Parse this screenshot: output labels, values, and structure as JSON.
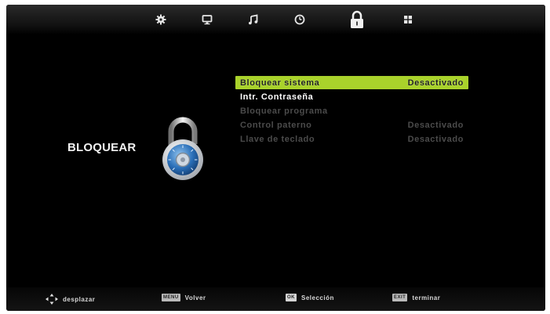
{
  "topbar": {
    "tabs": [
      {
        "icon": "gear-icon"
      },
      {
        "icon": "monitor-icon"
      },
      {
        "icon": "music-note-icon"
      },
      {
        "icon": "clock-icon"
      },
      {
        "icon": "padlock-icon",
        "active": true
      },
      {
        "icon": "grid-icon"
      }
    ]
  },
  "panel": {
    "title": "BLOQUEAR",
    "icon": "combination-padlock-icon"
  },
  "menu": {
    "items": [
      {
        "label": "Bloquear sistema",
        "value": "Desactivado",
        "state": "selected"
      },
      {
        "label": "Intr. Contraseña",
        "value": "",
        "state": "enabled"
      },
      {
        "label": "Bloquear programa",
        "value": "",
        "state": "disabled"
      },
      {
        "label": "Control paterno",
        "value": "Desactivado",
        "state": "disabled"
      },
      {
        "label": "Llave de teclado",
        "value": "Desactivado",
        "state": "disabled"
      }
    ]
  },
  "bottombar": {
    "hints": [
      {
        "key": "",
        "label": "desplazar",
        "icon": "dpad-arrows-icon"
      },
      {
        "key": "MENU",
        "label": "Volver"
      },
      {
        "key": "OK",
        "label": "Selección"
      },
      {
        "key": "EXIT",
        "label": "terminar"
      }
    ]
  },
  "colors": {
    "selection": "#a9d22b",
    "background": "#000000",
    "text": "#ffffff",
    "disabled_text": "#4b4b4b"
  }
}
